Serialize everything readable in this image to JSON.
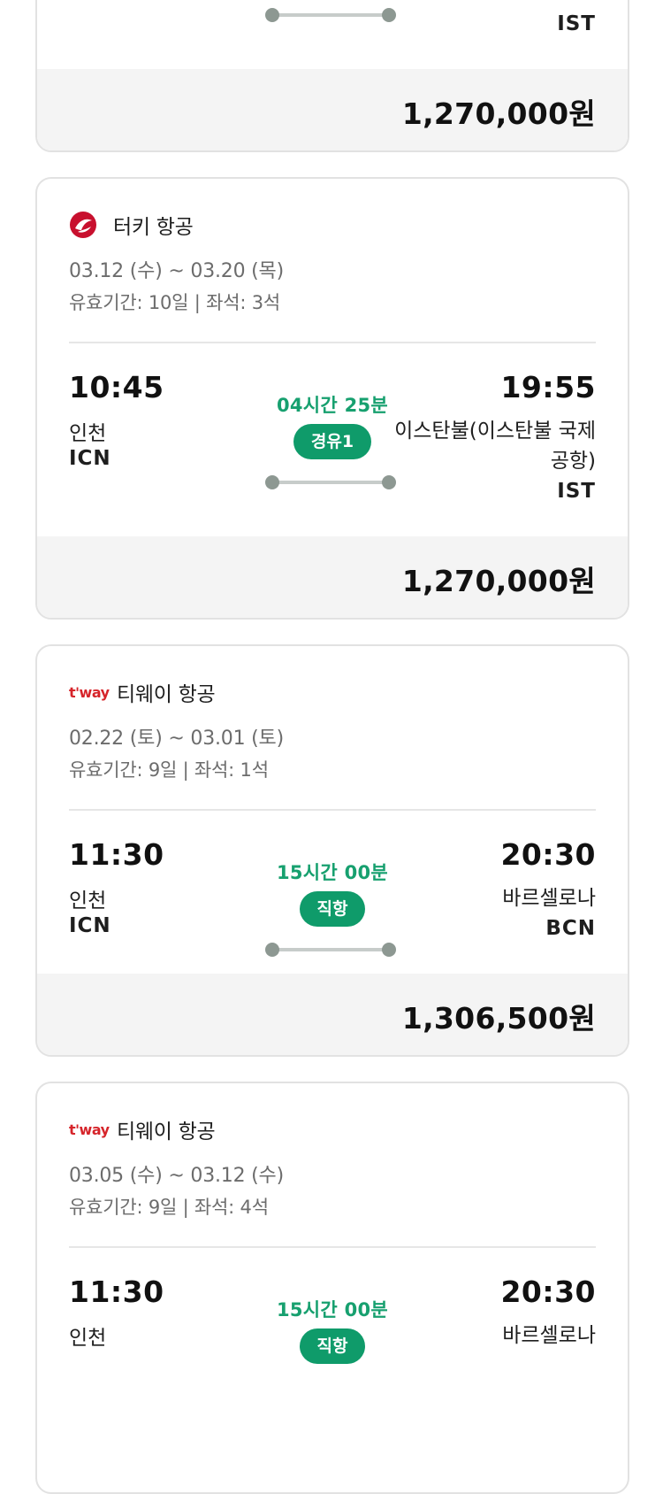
{
  "card0": {
    "arr_code": "IST",
    "price": "1,270,000원"
  },
  "card1": {
    "airline": "터키 항공",
    "logo_icon": "turkish-airlines-logo",
    "dates": "03.12 (수) ~ 03.20 (목)",
    "validity": "유효기간: 10일 | 좌석: 3석",
    "dep_time": "10:45",
    "dep_city": "인천",
    "dep_code": "ICN",
    "duration": "04시간 25분",
    "stops": "경유1",
    "arr_time": "19:55",
    "arr_city": "이스탄불(이스탄불 국제공항)",
    "arr_code": "IST",
    "price": "1,270,000원"
  },
  "card2": {
    "airline": "티웨이 항공",
    "logo_text": "t'way",
    "dates": "02.22 (토) ~ 03.01 (토)",
    "validity": "유효기간: 9일 | 좌석: 1석",
    "dep_time": "11:30",
    "dep_city": "인천",
    "dep_code": "ICN",
    "duration": "15시간 00분",
    "stops": "직항",
    "arr_time": "20:30",
    "arr_city": "바르셀로나",
    "arr_code": "BCN",
    "price": "1,306,500원"
  },
  "card3": {
    "airline": "티웨이 항공",
    "logo_text": "t'way",
    "dates": "03.05 (수) ~ 03.12 (수)",
    "validity": "유효기간: 9일 | 좌석: 4석",
    "dep_time": "11:30",
    "dep_city": "인천",
    "duration": "15시간 00분",
    "stops": "직항",
    "arr_time": "20:30",
    "arr_city": "바르셀로나"
  },
  "colors": {
    "accent_green": "#0f9b6a",
    "duration_green": "#17a06f",
    "turkish_red": "#c8102e",
    "tway_red": "#d6242a"
  }
}
